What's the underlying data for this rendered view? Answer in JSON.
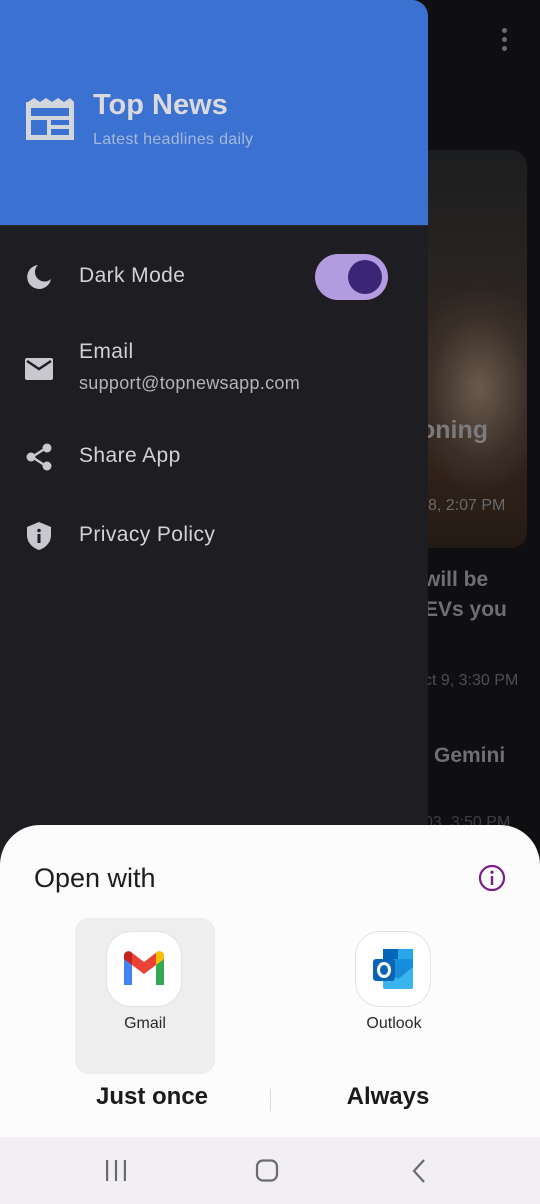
{
  "background_feed": {
    "card_title_fragment": "oning",
    "card_time_fragment": "8, 2:07 PM",
    "headline_fragment": "will be\nEVs you",
    "time_fragment_2": "ct 9, 3:30 PM",
    "headline_fragment_3": "Gemini",
    "time_fragment_3": "03, 3:50 PM"
  },
  "drawer": {
    "title": "Top News",
    "subtitle": "Latest headlines daily",
    "header_icon": "newspaper-icon",
    "colors": {
      "header": "#3b72d2",
      "background": "#1e1d21",
      "toggle_track": "#b39be0",
      "toggle_knob": "#3b2575"
    },
    "items": [
      {
        "icon": "moon-icon",
        "label": "Dark Mode",
        "toggle_on": true
      },
      {
        "icon": "mail-icon",
        "label": "Email",
        "sublabel": "support@topnewsapp.com"
      },
      {
        "icon": "share-icon",
        "label": "Share App"
      },
      {
        "icon": "shield-info-icon",
        "label": "Privacy Policy"
      }
    ]
  },
  "sheet": {
    "title": "Open with",
    "info_icon": "info-icon",
    "apps": [
      {
        "name": "Gmail",
        "icon": "gmail-icon",
        "selected": true
      },
      {
        "name": "Outlook",
        "icon": "outlook-icon",
        "selected": false
      }
    ],
    "actions": {
      "just_once": "Just once",
      "always": "Always"
    },
    "colors": {
      "accent": "#7b1d86"
    }
  },
  "navbar": {
    "buttons": [
      "recent-apps-icon",
      "home-icon",
      "back-icon"
    ]
  }
}
